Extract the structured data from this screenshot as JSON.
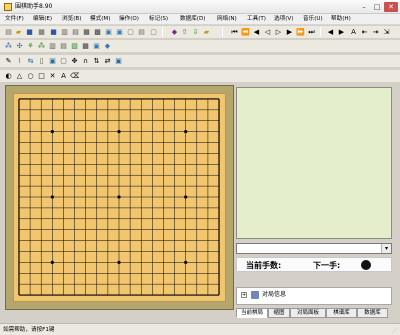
{
  "window": {
    "title": "围棋助手8.90"
  },
  "menu": [
    "文件(F)",
    "编辑(E)",
    "浏览(B)",
    "模式(M)",
    "操作(O)",
    "标记(S)",
    "数据库(D)",
    "网络(N)",
    "工具(T)",
    "选项(V)",
    "音乐(U)",
    "帮助(H)"
  ],
  "board": {
    "size": 19,
    "star_points": [
      [
        3,
        3
      ],
      [
        3,
        9
      ],
      [
        3,
        15
      ],
      [
        9,
        3
      ],
      [
        9,
        9
      ],
      [
        9,
        15
      ],
      [
        15,
        3
      ],
      [
        15,
        9
      ],
      [
        15,
        15
      ]
    ]
  },
  "info": {
    "move_label": "当前手数:",
    "next_label": "下一手:"
  },
  "tree": {
    "item": "对局信息"
  },
  "tabs": [
    "当前棋局",
    "缩图",
    "对局面板",
    "棋谱库",
    "数据库"
  ],
  "status": {
    "text": "如需帮助，请按F1键"
  },
  "colors": {
    "board": "#f2c66f",
    "board_frame": "#b5a66b",
    "preview_bg": "#e4eecd"
  }
}
